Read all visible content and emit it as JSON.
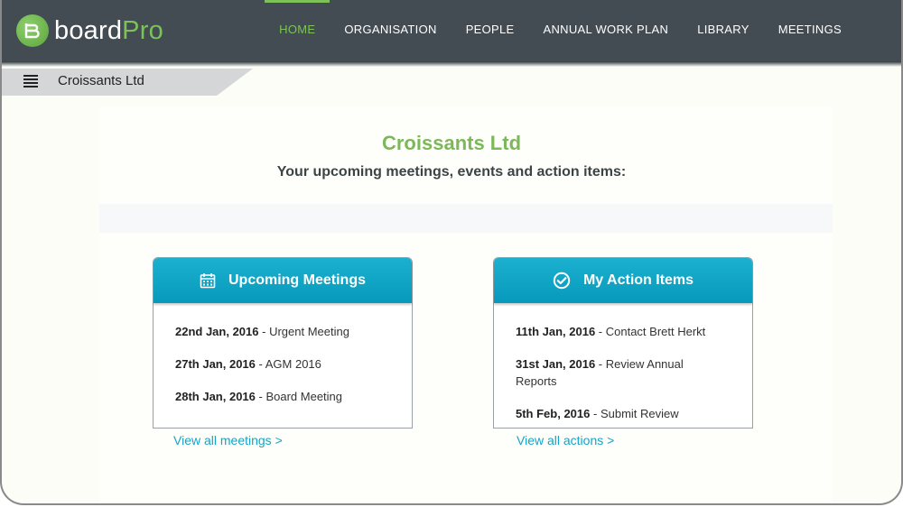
{
  "app": {
    "logo_board": "board",
    "logo_pro": "Pro"
  },
  "nav": [
    {
      "label": "HOME"
    },
    {
      "label": "ORGANISATION"
    },
    {
      "label": "PEOPLE"
    },
    {
      "label": "ANNUAL WORK PLAN"
    },
    {
      "label": "LIBRARY"
    },
    {
      "label": "MEETINGS"
    }
  ],
  "breadcrumb": {
    "title": "Croissants Ltd"
  },
  "main": {
    "org_title": "Croissants Ltd",
    "subtitle": "Your upcoming meetings, events and action items:"
  },
  "meetings": {
    "title": "Upcoming Meetings",
    "icon": "calendar-icon",
    "items": [
      {
        "date": "22nd Jan, 2016",
        "sep": " - ",
        "text": "Urgent Meeting"
      },
      {
        "date": "27th Jan, 2016",
        "sep": " - ",
        "text": "AGM 2016"
      },
      {
        "date": "28th Jan, 2016",
        "sep": " - ",
        "text": "Board Meeting"
      }
    ],
    "link": "View all meetings >"
  },
  "actions": {
    "title": "My Action Items",
    "icon": "check-circle-icon",
    "items": [
      {
        "date": "11th Jan, 2016",
        "sep": " - ",
        "text": "Contact Brett Herkt"
      },
      {
        "date": "31st Jan, 2016",
        "sep": " - ",
        "text": "Review Annual Reports"
      },
      {
        "date": "5th Feb, 2016",
        "sep": " - ",
        "text": "Submit Review"
      }
    ],
    "link": "View all actions >"
  },
  "colors": {
    "accent_green": "#7cb85a",
    "header_bg": "#434c53",
    "card_head": "#0ba3c4",
    "link": "#13a4c8"
  }
}
